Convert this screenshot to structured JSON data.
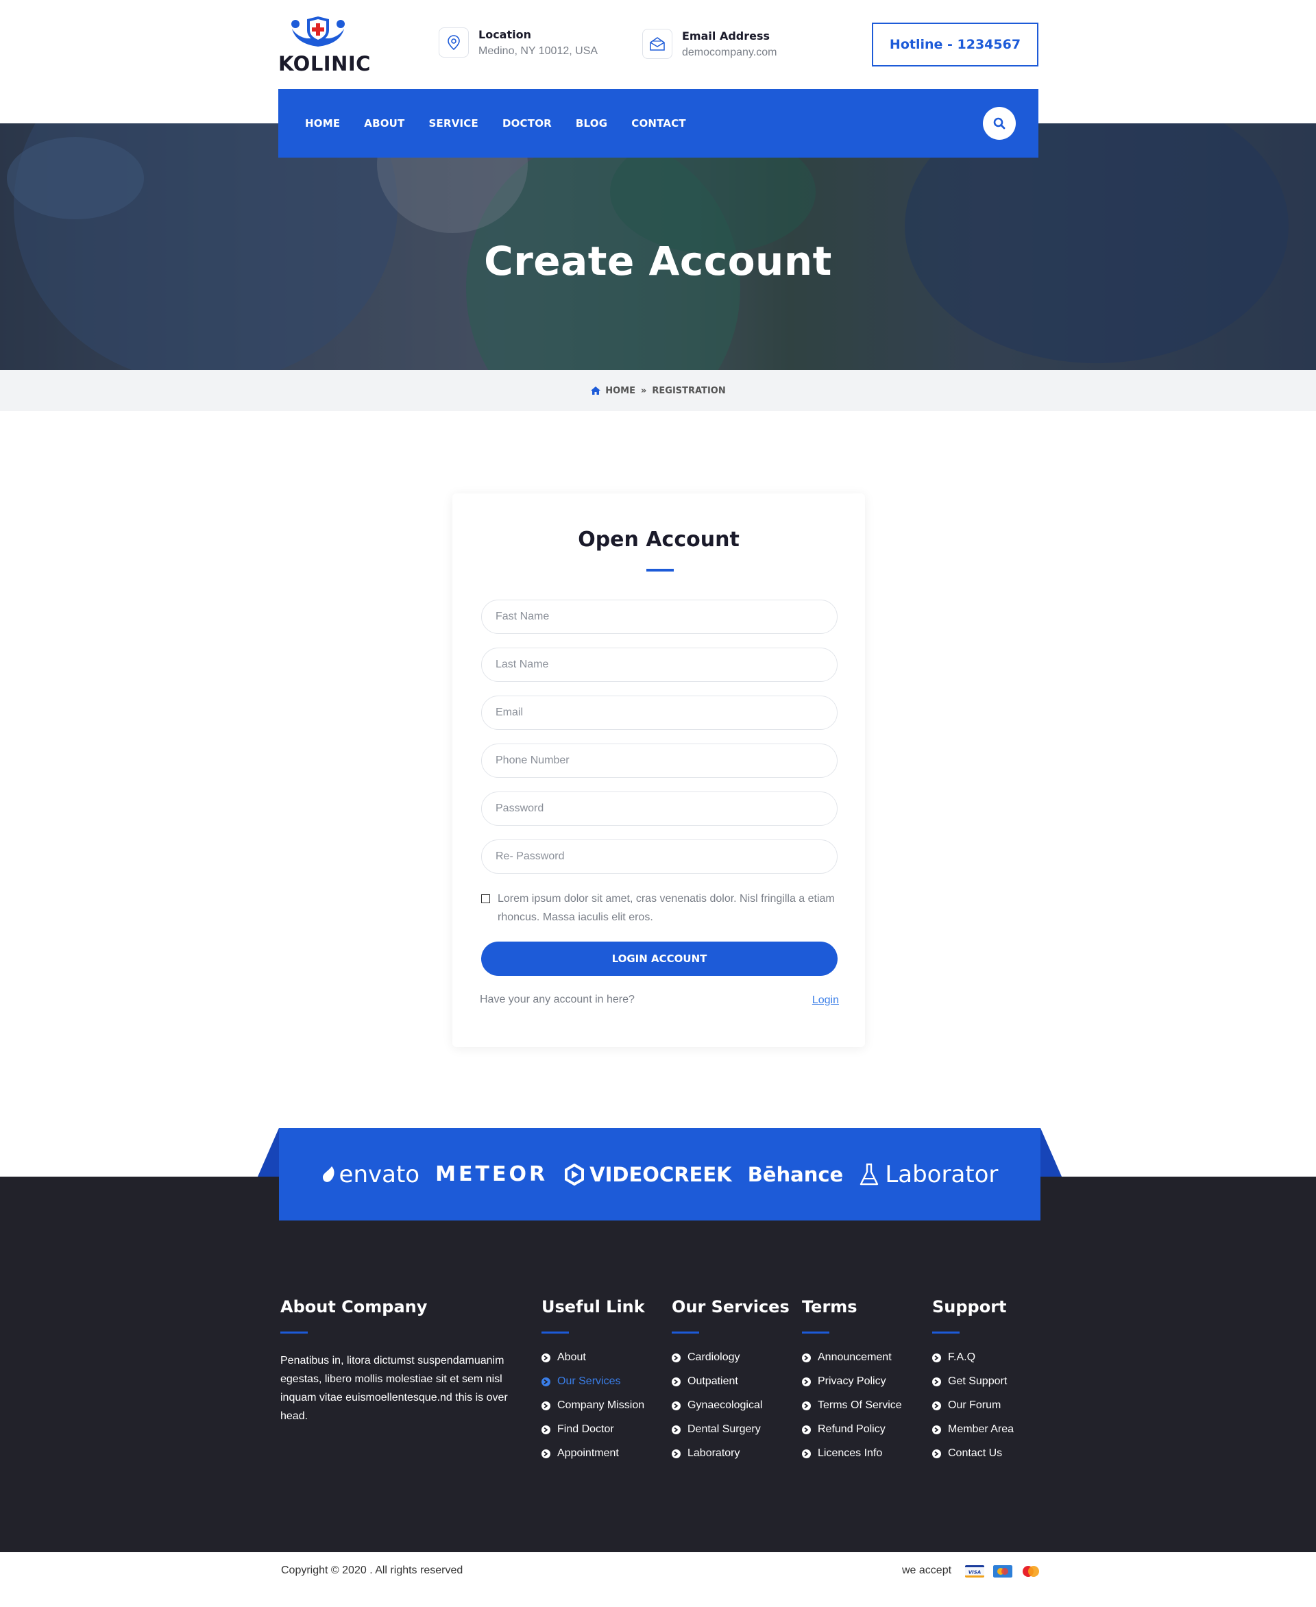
{
  "header": {
    "logo_text": "KOLINIC",
    "location": {
      "title": "Location",
      "text": "Medino, NY 10012, USA"
    },
    "email": {
      "title": "Email Address",
      "text": "democompany.com"
    },
    "hotline": "Hotline - 1234567"
  },
  "nav": {
    "items": [
      "HOME",
      "ABOUT",
      "SERVICE",
      "DOCTOR",
      "BLOG",
      "CONTACT"
    ]
  },
  "hero": {
    "title": "Create Account"
  },
  "breadcrumb": {
    "home": "HOME",
    "current": "REGISTRATION"
  },
  "form": {
    "title": "Open Account",
    "fields": {
      "first_name": "Fast Name",
      "last_name": "Last Name",
      "email": "Email",
      "phone": "Phone Number",
      "password": "Password",
      "re_password": "Re- Password"
    },
    "terms_text": "Lorem ipsum dolor sit amet, cras venenatis dolor. Nisl fringilla a etiam rhoncus. Massa  iaculis elit eros.",
    "submit": "LOGIN ACCOUNT",
    "have_account": "Have your any account in here?",
    "login_link": "Login"
  },
  "brands": [
    "envato",
    "METEOR",
    "VIDEOCREEK",
    "Bēhance",
    "Laborator"
  ],
  "footer": {
    "about": {
      "title": "About Company",
      "text": "Penatibus in, litora dictumst suspendamuanim egestas, libero mollis molestiae sit et sem nisl inquam vitae euismoellentesque.nd this is over head."
    },
    "useful": {
      "title": "Useful Link",
      "items": [
        "About",
        "Our Services",
        "Company Mission",
        "Find Doctor",
        "Appointment"
      ],
      "active": "Our Services"
    },
    "services": {
      "title": "Our Services",
      "items": [
        "Cardiology",
        "Outpatient",
        "Gynaecological",
        "Dental Surgery",
        "Laboratory"
      ]
    },
    "terms": {
      "title": "Terms",
      "items": [
        "Announcement",
        "Privacy Policy",
        "Terms Of Service",
        "Refund Policy",
        "Licences Info"
      ]
    },
    "support": {
      "title": "Support",
      "items": [
        "F.A.Q",
        "Get Support",
        "Our Forum",
        "Member Area",
        "Contact Us"
      ]
    },
    "copyright": "Copyright © 2020 . All rights reserved",
    "we_accept": "we accept",
    "payment_icons": [
      "visa-icon",
      "credit-card-icon",
      "mastercard-icon"
    ]
  },
  "colors": {
    "primary": "#1d5bd8",
    "footer_bg": "#22222a",
    "link": "#3a7ee8"
  }
}
